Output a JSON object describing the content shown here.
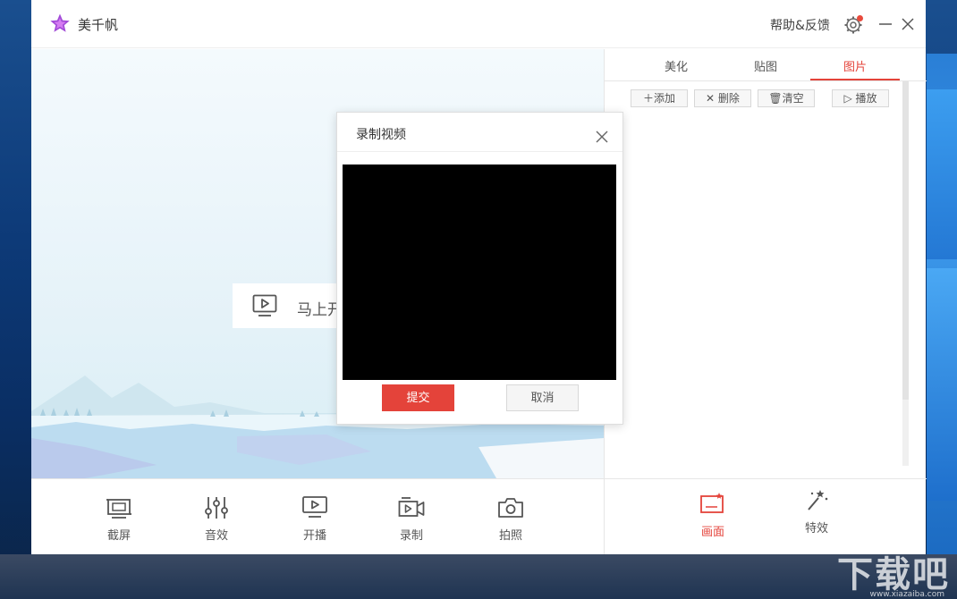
{
  "app": {
    "title": "美千帆",
    "help_feedback": "帮助&反馈"
  },
  "preview": {
    "start_label": "马上开"
  },
  "toolbar": {
    "items": [
      {
        "label": "截屏",
        "icon": "screenshot-icon"
      },
      {
        "label": "音效",
        "icon": "sound-effects-icon"
      },
      {
        "label": "开播",
        "icon": "live-start-icon"
      },
      {
        "label": "录制",
        "icon": "record-camera-icon"
      },
      {
        "label": "拍照",
        "icon": "photo-camera-icon"
      }
    ]
  },
  "right_panel": {
    "tabs": [
      {
        "label": "美化",
        "active": false
      },
      {
        "label": "贴图",
        "active": false
      },
      {
        "label": "图片",
        "active": true
      }
    ],
    "actions": [
      {
        "label": "添加",
        "icon": "plus-icon"
      },
      {
        "label": "删除",
        "icon": "x-icon"
      },
      {
        "label": "清空",
        "icon": "trash-icon"
      },
      {
        "label": "播放",
        "icon": "play-icon"
      }
    ],
    "bottom": [
      {
        "label": "画面",
        "active": true,
        "icon": "scene-icon"
      },
      {
        "label": "特效",
        "active": false,
        "icon": "magic-wand-icon"
      }
    ]
  },
  "dialog": {
    "title": "录制视频",
    "submit_label": "提交",
    "cancel_label": "取消"
  },
  "watermark": {
    "text": "下载吧",
    "url": "www.xiazaiba.com"
  },
  "colors": {
    "accent": "#e4433a",
    "logo": "#a24bd8"
  }
}
